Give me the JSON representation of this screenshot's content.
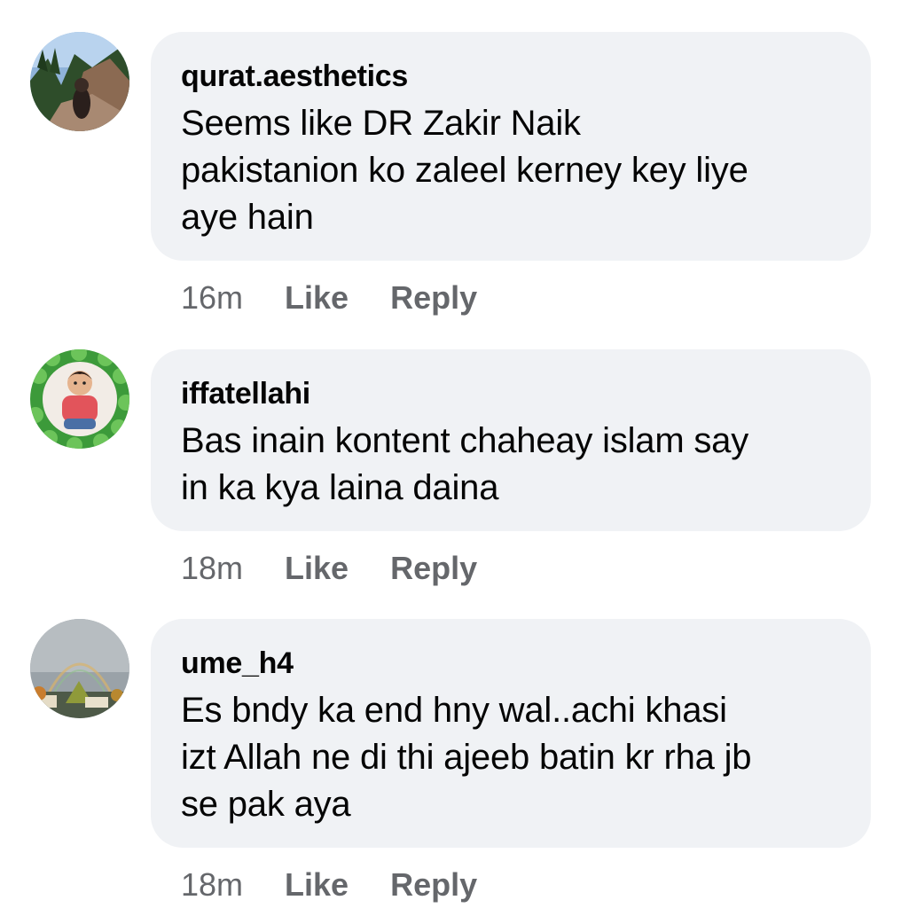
{
  "comments": [
    {
      "username": "qurat.aesthetics",
      "lines": [
        "Seems like DR Zakir Naik",
        "pakistanion ko zaleel kerney key liye",
        "aye hain"
      ],
      "time": "16m",
      "like_label": "Like",
      "reply_label": "Reply",
      "avatar_icon": "mountain-photo-avatar"
    },
    {
      "username": "iffatellahi",
      "lines": [
        "Bas inain kontent chaheay islam say",
        "in ka kya laina daina"
      ],
      "time": "18m",
      "like_label": "Like",
      "reply_label": "Reply",
      "avatar_icon": "child-photo-avatar"
    },
    {
      "username": "ume_h4",
      "lines": [
        "Es bndy ka end hny wal..achi khasi",
        "izt Allah ne di thi ajeeb batin kr rha jb",
        "se pak aya"
      ],
      "time": "18m",
      "like_label": "Like",
      "reply_label": "Reply",
      "avatar_icon": "rainbow-photo-avatar"
    }
  ],
  "colors": {
    "bubble": "#f0f2f5",
    "text": "#050505",
    "secondary": "#65676b"
  }
}
